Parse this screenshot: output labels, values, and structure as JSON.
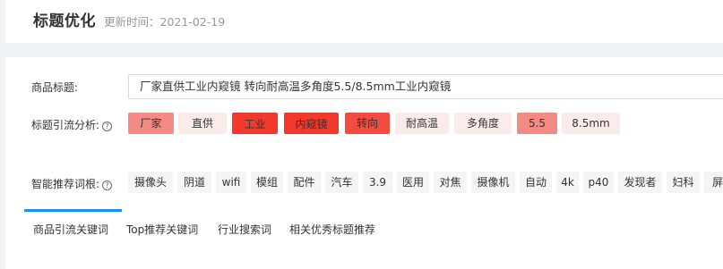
{
  "header": {
    "title": "标题优化",
    "updated": "更新时间：2021-02-19"
  },
  "product_title": {
    "label": "商品标题:",
    "value": "厂家直供工业内窥镜 转向耐高温多角度5.5/8.5mm工业内窥镜"
  },
  "analysis": {
    "label": "标题引流分析:",
    "help_icon": "?",
    "chips": [
      {
        "text": "厂家",
        "level": 2
      },
      {
        "text": "直供",
        "level": 1
      },
      {
        "text": "工业",
        "level": 4
      },
      {
        "text": "内窥镜",
        "level": 4
      },
      {
        "text": "转向",
        "level": 3
      },
      {
        "text": "耐高温",
        "level": 1
      },
      {
        "text": "多角度",
        "level": 1
      },
      {
        "text": "5.5",
        "level": 2
      },
      {
        "text": "8.5mm",
        "level": 1
      }
    ]
  },
  "recommend": {
    "label": "智能推荐词根:",
    "help_icon": "?",
    "words": [
      "摄像头",
      "阴道",
      "wifi",
      "模组",
      "配件",
      "汽车",
      "3.9",
      "医用",
      "对焦",
      "摄像机",
      "自动",
      "4k",
      "p40",
      "发现者",
      "妇科",
      "屏"
    ]
  },
  "tabs": [
    {
      "label": "商品引流关键词",
      "active": true
    },
    {
      "label": "Top推荐关键词",
      "active": false
    },
    {
      "label": "行业搜索词",
      "active": false
    },
    {
      "label": "相关优秀标题推荐",
      "active": false
    }
  ],
  "colors": {
    "level1": "#fbeceb",
    "level2": "#f48a84",
    "level3": "#f44b40",
    "level4": "#f2392c",
    "accent": "#1890ff"
  }
}
